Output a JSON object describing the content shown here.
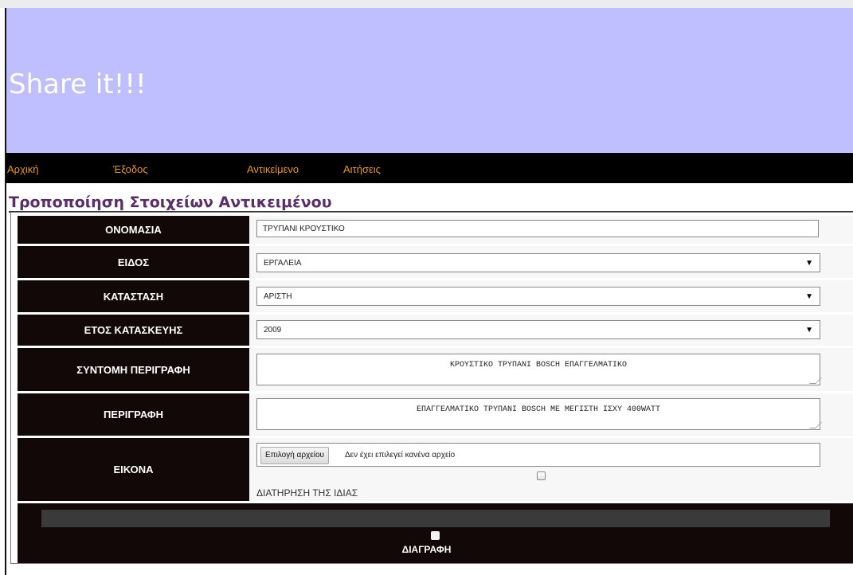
{
  "header": {
    "title": "Share it!!!"
  },
  "nav": [
    "Αρχική",
    "Έξοδος",
    "Αντικείμενο",
    "Αιτήσεις"
  ],
  "page_title": "Τροποποίηση Στοιχείων Αντικειμένου",
  "form": {
    "name": {
      "label": "ΟΝΟΜΑΣΙΑ",
      "value": "ΤΡΥΠΑΝΙ ΚΡΟΥΣΤΙΚΟ"
    },
    "type": {
      "label": "ΕΙΔΟΣ",
      "value": "ΕΡΓΑΛΕΙΑ"
    },
    "condition": {
      "label": "ΚΑΤΑΣΤΑΣΗ",
      "value": "ΑΡΙΣΤΗ"
    },
    "year": {
      "label": "ΕΤΟΣ ΚΑΤΑΣΚΕΥΗΣ",
      "value": "2009"
    },
    "short_desc": {
      "label": "ΣΥΝΤΟΜΗ ΠΕΡΙΓΡΑΦΗ",
      "value": "ΚΡΟΥΣΤΙΚΟ ΤΡΥΠΑΝΙ BOSCH ΕΠΑΓΓΕΛΜΑΤΙΚΟ"
    },
    "desc": {
      "label": "ΠΕΡΙΓΡΑΦΗ",
      "value": "ΕΠΑΓΓΕΛΜΑΤΙΚΟ ΤΡΥΠΑΝΙ BOSCH ΜΕ ΜΕΓΙΣΤΗ ΙΣΧΥ 400WATT"
    },
    "image": {
      "label": "ΕΙΚΟΝΑ",
      "button": "Επιλογή αρχείου",
      "status": "Δεν έχει επιλεγεί κανένα αρχείο",
      "keep_label": "ΔΙΑΤΗΡΗΣΗ ΤΗΣ ΙΔΙΑΣ"
    },
    "delete_label": "ΔΙΑΓΡΑΦΗ"
  }
}
